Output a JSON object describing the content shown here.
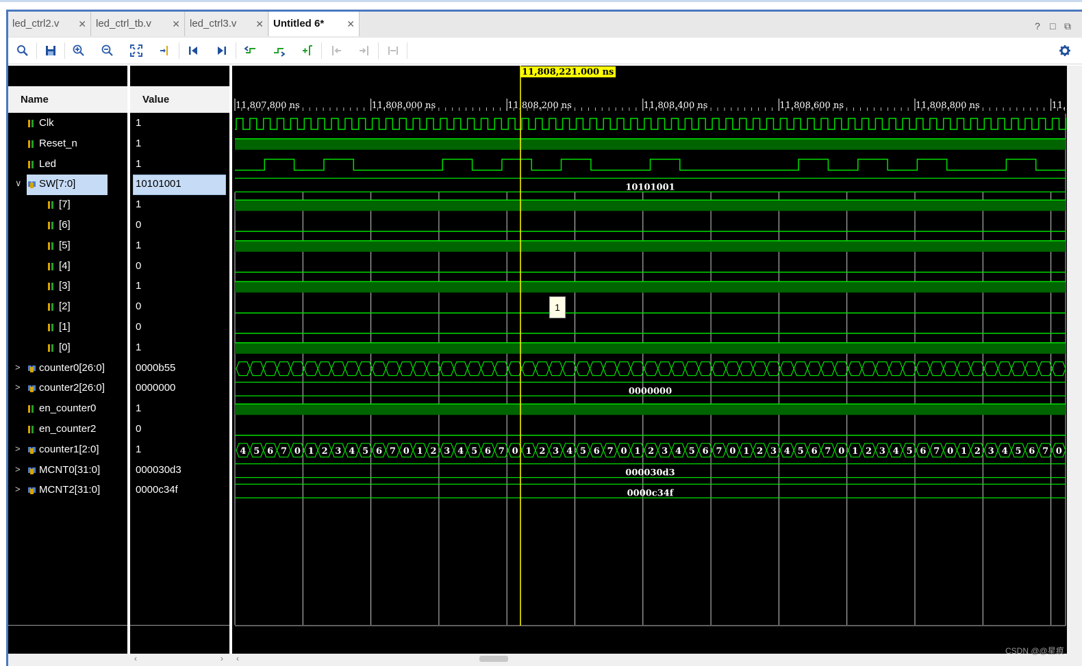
{
  "tabs": [
    {
      "label": "led_ctrl2.v",
      "active": false
    },
    {
      "label": "led_ctrl_tb.v",
      "active": false
    },
    {
      "label": "led_ctrl3.v",
      "active": false
    },
    {
      "label": "Untitled 6*",
      "active": true
    }
  ],
  "window_controls": {
    "help": "?",
    "restore": "□",
    "float": "⧉"
  },
  "toolbar": {
    "icons": [
      "search-icon",
      "save-icon",
      "zoom-in-icon",
      "zoom-out-icon",
      "zoom-fit-icon",
      "go-to-cursor-icon",
      "go-to-time-0-icon",
      "go-to-last-time-icon",
      "previous-transition-icon",
      "next-transition-icon",
      "add-marker-icon",
      "previous-marker-icon",
      "next-marker-icon",
      "swap-cursors-icon",
      "settings-gear-icon"
    ]
  },
  "columns": {
    "name": "Name",
    "value": "Value"
  },
  "cursor": {
    "label": "11,808,221.000 ns",
    "color": "#ffff00"
  },
  "time_axis": {
    "labels": [
      "11,807,800 ns",
      "11,808,000 ns",
      "11,808,200 ns",
      "11,808,400 ns",
      "11,808,600 ns",
      "11,808,800 ns",
      "11,"
    ]
  },
  "signals": [
    {
      "name": "Clk",
      "value": "1",
      "kind": "bit",
      "indent": 0,
      "expander": ""
    },
    {
      "name": "Reset_n",
      "value": "1",
      "kind": "bit",
      "indent": 0,
      "expander": ""
    },
    {
      "name": "Led",
      "value": "1",
      "kind": "bit",
      "indent": 0,
      "expander": ""
    },
    {
      "name": "SW[7:0]",
      "value": "10101001",
      "kind": "bus",
      "indent": 0,
      "expander": "∨",
      "selected": true
    },
    {
      "name": "[7]",
      "value": "1",
      "kind": "bit",
      "indent": 1,
      "expander": ""
    },
    {
      "name": "[6]",
      "value": "0",
      "kind": "bit",
      "indent": 1,
      "expander": ""
    },
    {
      "name": "[5]",
      "value": "1",
      "kind": "bit",
      "indent": 1,
      "expander": ""
    },
    {
      "name": "[4]",
      "value": "0",
      "kind": "bit",
      "indent": 1,
      "expander": ""
    },
    {
      "name": "[3]",
      "value": "1",
      "kind": "bit",
      "indent": 1,
      "expander": ""
    },
    {
      "name": "[2]",
      "value": "0",
      "kind": "bit",
      "indent": 1,
      "expander": ""
    },
    {
      "name": "[1]",
      "value": "0",
      "kind": "bit",
      "indent": 1,
      "expander": ""
    },
    {
      "name": "[0]",
      "value": "1",
      "kind": "bit",
      "indent": 1,
      "expander": ""
    },
    {
      "name": "counter0[26:0]",
      "value": "0000b55",
      "kind": "bus",
      "indent": 0,
      "expander": ">"
    },
    {
      "name": "counter2[26:0]",
      "value": "0000000",
      "kind": "bus",
      "indent": 0,
      "expander": ">"
    },
    {
      "name": "en_counter0",
      "value": "1",
      "kind": "bit",
      "indent": 0,
      "expander": ""
    },
    {
      "name": "en_counter2",
      "value": "0",
      "kind": "bit",
      "indent": 0,
      "expander": ""
    },
    {
      "name": "counter1[2:0]",
      "value": "1",
      "kind": "bus",
      "indent": 0,
      "expander": ">"
    },
    {
      "name": "MCNT0[31:0]",
      "value": "000030d3",
      "kind": "bus",
      "indent": 0,
      "expander": ">"
    },
    {
      "name": "MCNT2[31:0]",
      "value": "0000c34f",
      "kind": "bus",
      "indent": 0,
      "expander": ">"
    }
  ],
  "bus_labels": {
    "sw": "10101001",
    "counter2": "0000000",
    "mcnt0": "000030d3",
    "mcnt2": "0000c34f"
  },
  "counter1_sequence": [
    "4",
    "5",
    "6",
    "7",
    "0",
    "1",
    "2",
    "3",
    "4",
    "5",
    "6",
    "7",
    "0",
    "1",
    "2",
    "3",
    "4",
    "5",
    "6",
    "7",
    "0",
    "1",
    "2",
    "3",
    "4",
    "5",
    "6",
    "7",
    "0",
    "1",
    "2",
    "3",
    "4",
    "5",
    "6",
    "7",
    "0",
    "1",
    "2",
    "3",
    "4",
    "5",
    "6",
    "7",
    "0",
    "1",
    "2",
    "3",
    "4",
    "5",
    "6",
    "7",
    "0",
    "1",
    "2",
    "3",
    "4",
    "5",
    "6",
    "7",
    "0"
  ],
  "led_pattern": "0101000101010010000101010010",
  "tooltip": "1",
  "colors": {
    "wave": "#00e000",
    "wave_fill": "#006400",
    "grid": "#cfcfcf",
    "cursor": "#ffff00",
    "selection": "#c6dcf6"
  },
  "watermark": "CSDN @@星痕"
}
